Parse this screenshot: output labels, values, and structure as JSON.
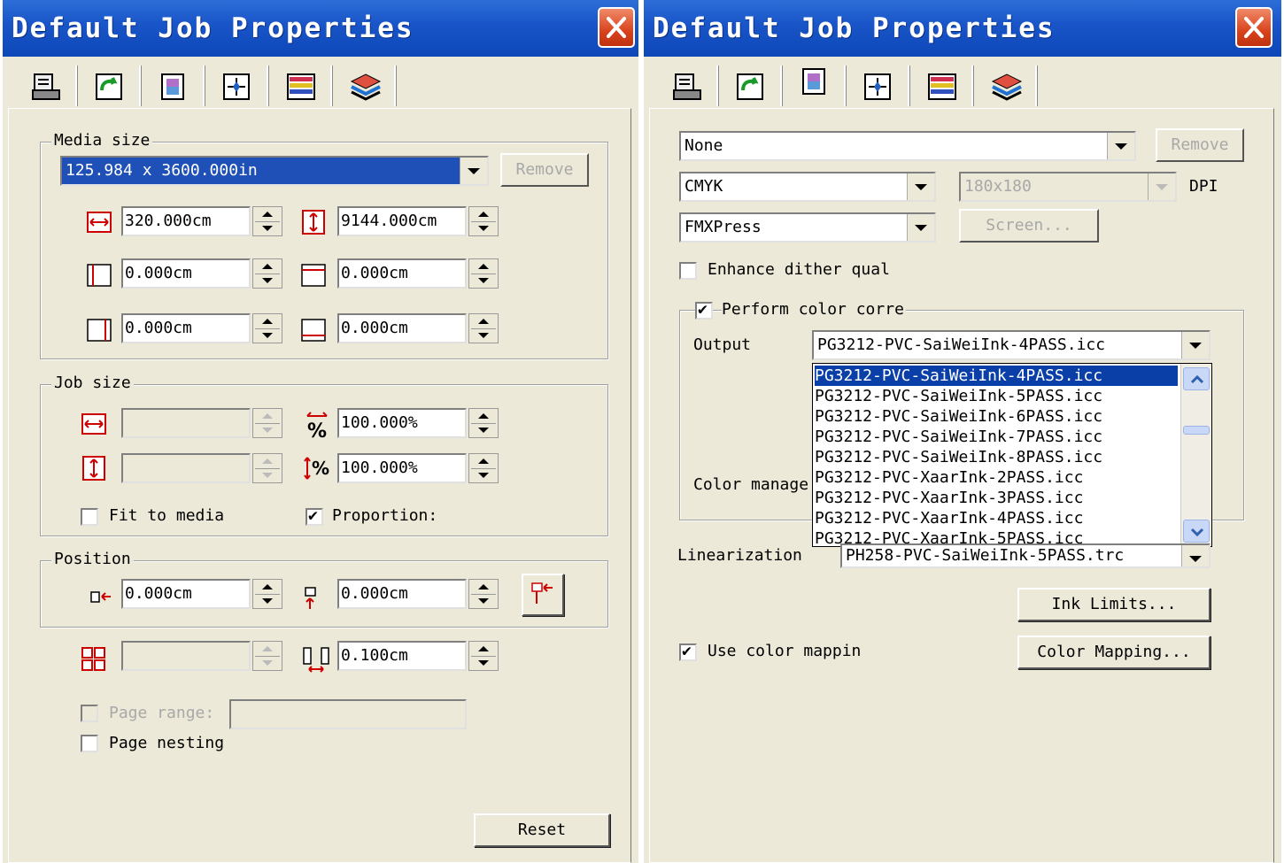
{
  "left_window": {
    "title": "Default Job Properties",
    "media_group": {
      "legend": "Media size",
      "media_size_value": "125.984 x 3600.000in",
      "remove_label": "Remove",
      "width": "320.000cm",
      "height": "9144.000cm",
      "margin_left": "0.000cm",
      "margin_top": "0.000cm",
      "margin_right": "0.000cm",
      "margin_bottom": "0.000cm"
    },
    "job_group": {
      "legend": "Job size",
      "width": "",
      "scale_x": "100.000%",
      "height": "",
      "scale_y": "100.000%",
      "fit_to_media_label": "Fit to media",
      "fit_to_media_checked": false,
      "proportional_label": "Proportion:",
      "proportional_checked": true
    },
    "position_group": {
      "legend": "Position",
      "x": "0.000cm",
      "y": "0.000cm"
    },
    "tile_count": "",
    "spacing": "0.100cm",
    "page_range_label": "Page range:",
    "page_range_value": "",
    "page_nesting_label": "Page nesting",
    "reset_label": "Reset"
  },
  "right_window": {
    "title": "Default Job Properties",
    "profile_select": "None",
    "remove_label": "Remove",
    "color_mode": "CMYK",
    "resolution": "180x180",
    "dpi_label": "DPI",
    "dither": "FMXPress",
    "screen_label": "Screen...",
    "enhance_dither_label": "Enhance dither qual",
    "enhance_dither_checked": false,
    "color_correction_legend": "Perform color corre",
    "color_correction_checked": true,
    "output_label": "Output",
    "output_value": "PG3212-PVC-SaiWeiInk-4PASS.icc",
    "color_manage_label": "Color manage",
    "output_options": [
      "PG3212-PVC-SaiWeiInk-4PASS.icc",
      "PG3212-PVC-SaiWeiInk-5PASS.icc",
      "PG3212-PVC-SaiWeiInk-6PASS.icc",
      "PG3212-PVC-SaiWeiInk-7PASS.icc",
      "PG3212-PVC-SaiWeiInk-8PASS.icc",
      "PG3212-PVC-XaarInk-2PASS.icc",
      "PG3212-PVC-XaarInk-3PASS.icc",
      "PG3212-PVC-XaarInk-4PASS.icc",
      "PG3212-PVC-XaarInk-5PASS.icc"
    ],
    "selected_option_index": 0,
    "linearization_label": "Linearization",
    "linearization_value": "PH258-PVC-SaiWeiInk-5PASS.trc",
    "ink_limits_label": "Ink Limits...",
    "use_color_mapping_label": "Use color mappin",
    "use_color_mapping_checked": true,
    "color_mapping_label": "Color Mapping..."
  },
  "colors": {
    "titlebar": "#1a56c9",
    "dialog_bg": "#ece9d8",
    "selection": "#0a3fa8",
    "close_button": "#d9431d"
  },
  "tab_icons": [
    "printer-icon",
    "rotate-icon",
    "color-icon",
    "layout-icon",
    "stripes-icon",
    "layers-icon"
  ]
}
